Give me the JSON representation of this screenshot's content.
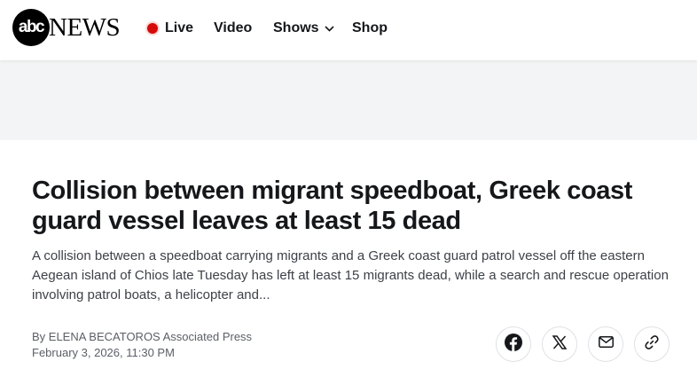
{
  "header": {
    "logo": {
      "abc": "abc",
      "news": "NEWS"
    },
    "nav": {
      "live": "Live",
      "video": "Video",
      "shows": "Shows",
      "shop": "Shop"
    }
  },
  "article": {
    "headline": "Collision between migrant speedboat, Greek coast guard vessel leaves at least 15 dead",
    "dek": "A collision between a speedboat carrying migrants and a Greek coast guard patrol vessel off the eastern Aegean island of Chios late Tuesday has left at least 15 migrants dead, while a search and rescue operation involving patrol boats, a helicopter and...",
    "byline": "By ELENA BECATOROS Associated Press",
    "timestamp": "February 3, 2026, 11:30 PM"
  },
  "share": {
    "icons": [
      "facebook-icon",
      "x-icon",
      "mail-icon",
      "link-icon"
    ]
  },
  "colors": {
    "live_dot": "#d50a0a",
    "text": "#15171a",
    "muted": "#5b5f66",
    "ad_band": "#f3f4f5"
  }
}
